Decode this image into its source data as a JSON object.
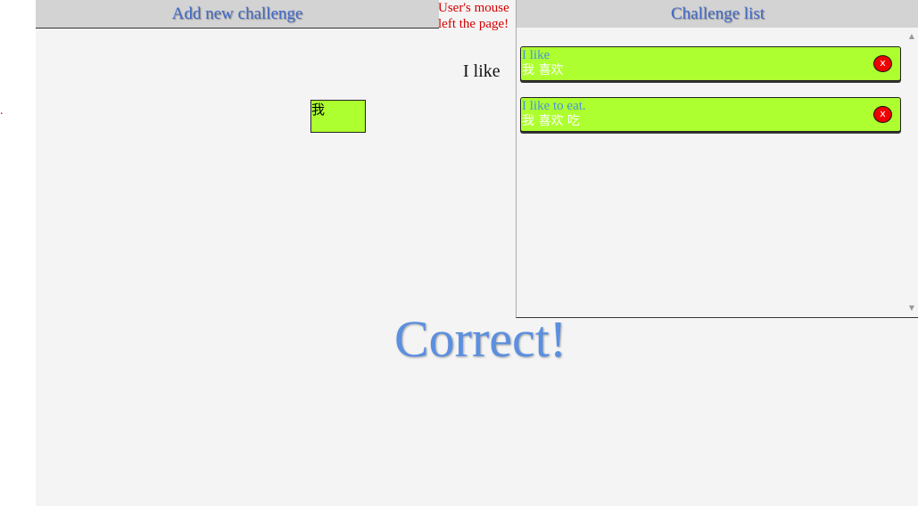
{
  "left_marker": ".",
  "add_panel": {
    "title": "Add new challenge"
  },
  "mouse_warning": {
    "line1": "User's mouse",
    "line2": "left the page!"
  },
  "prompt": {
    "text": "I like"
  },
  "answer_tile": {
    "text": "我"
  },
  "challenge_list": {
    "title": "Challenge list",
    "items": [
      {
        "english": "I like",
        "chinese": "我 喜欢",
        "delete_label": "x"
      },
      {
        "english": "I like to eat.",
        "chinese": "我 喜欢 吃",
        "delete_label": "x"
      }
    ]
  },
  "result": {
    "text": "Correct!"
  },
  "colors": {
    "tile_green": "#adff2f",
    "header_blue": "#4169c9",
    "warning_red": "#d40000",
    "delete_red": "#ee0000",
    "result_blue": "#5b8fe0"
  },
  "icons": {
    "scroll_up": "scroll-up-arrow-icon",
    "scroll_down": "scroll-down-arrow-icon"
  }
}
